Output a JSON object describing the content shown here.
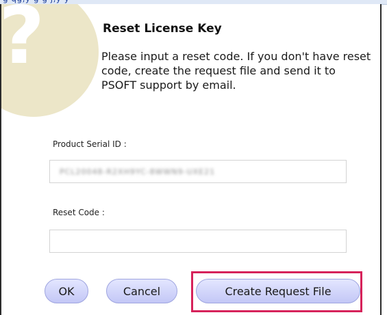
{
  "dialog": {
    "title": "Reset License Key",
    "message": "Please input a reset code. If you don't have reset code, create the request file and send it to PSOFT support by email.",
    "icon": "question-icon",
    "serial_field": {
      "label": "Product Serial ID :",
      "value": "PCL20048-R2XH9YC-8WWN9-UXE21"
    },
    "reset_field": {
      "label": "Reset Code :",
      "value": ""
    },
    "buttons": {
      "ok": "OK",
      "cancel": "Cancel",
      "create_request": "Create Request File"
    }
  },
  "colors": {
    "button_fill": "#c3c7f6",
    "highlight": "#d6225a",
    "icon_circle": "#ece6c8"
  }
}
